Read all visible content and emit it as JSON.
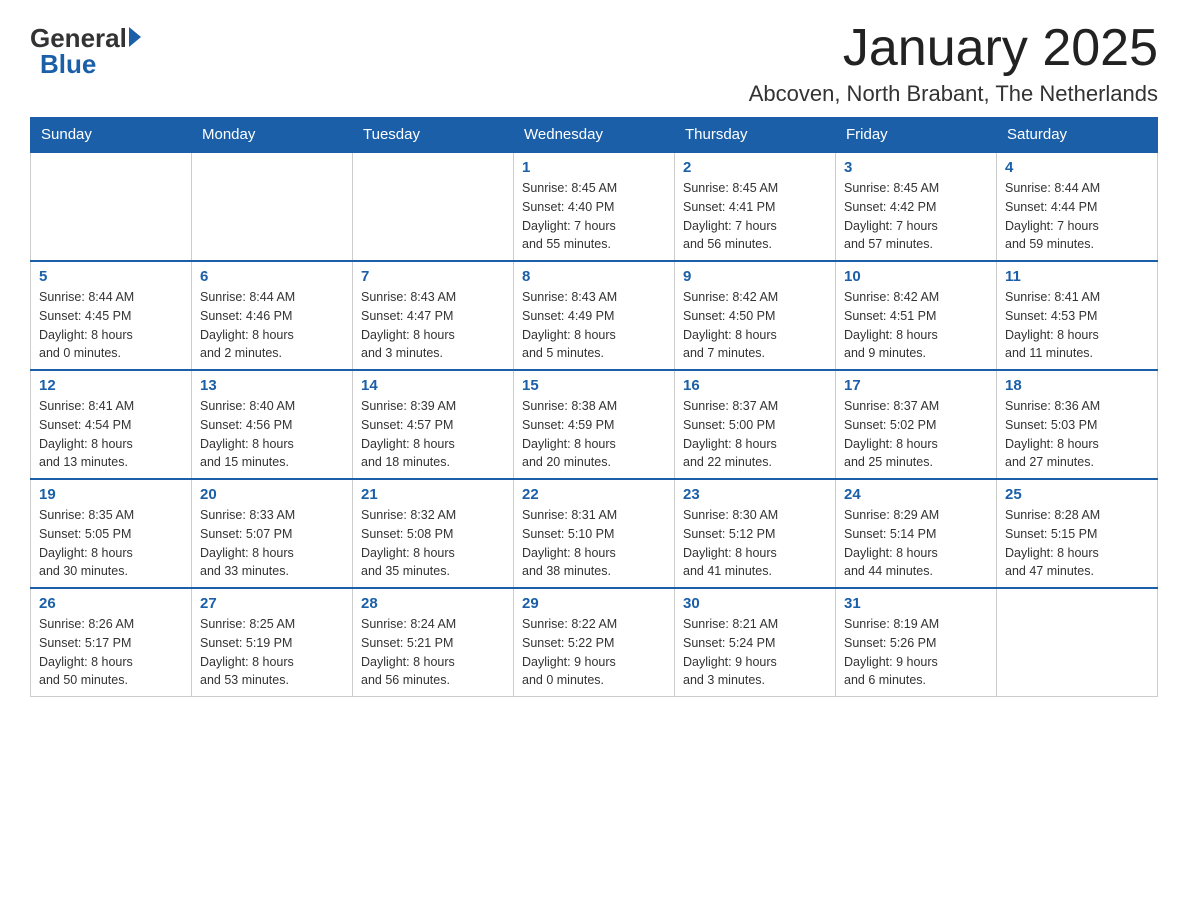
{
  "header": {
    "logo_general": "General",
    "logo_blue": "Blue",
    "month_title": "January 2025",
    "subtitle": "Abcoven, North Brabant, The Netherlands"
  },
  "days_of_week": [
    "Sunday",
    "Monday",
    "Tuesday",
    "Wednesday",
    "Thursday",
    "Friday",
    "Saturday"
  ],
  "weeks": [
    [
      {
        "day": "",
        "info": ""
      },
      {
        "day": "",
        "info": ""
      },
      {
        "day": "",
        "info": ""
      },
      {
        "day": "1",
        "info": "Sunrise: 8:45 AM\nSunset: 4:40 PM\nDaylight: 7 hours\nand 55 minutes."
      },
      {
        "day": "2",
        "info": "Sunrise: 8:45 AM\nSunset: 4:41 PM\nDaylight: 7 hours\nand 56 minutes."
      },
      {
        "day": "3",
        "info": "Sunrise: 8:45 AM\nSunset: 4:42 PM\nDaylight: 7 hours\nand 57 minutes."
      },
      {
        "day": "4",
        "info": "Sunrise: 8:44 AM\nSunset: 4:44 PM\nDaylight: 7 hours\nand 59 minutes."
      }
    ],
    [
      {
        "day": "5",
        "info": "Sunrise: 8:44 AM\nSunset: 4:45 PM\nDaylight: 8 hours\nand 0 minutes."
      },
      {
        "day": "6",
        "info": "Sunrise: 8:44 AM\nSunset: 4:46 PM\nDaylight: 8 hours\nand 2 minutes."
      },
      {
        "day": "7",
        "info": "Sunrise: 8:43 AM\nSunset: 4:47 PM\nDaylight: 8 hours\nand 3 minutes."
      },
      {
        "day": "8",
        "info": "Sunrise: 8:43 AM\nSunset: 4:49 PM\nDaylight: 8 hours\nand 5 minutes."
      },
      {
        "day": "9",
        "info": "Sunrise: 8:42 AM\nSunset: 4:50 PM\nDaylight: 8 hours\nand 7 minutes."
      },
      {
        "day": "10",
        "info": "Sunrise: 8:42 AM\nSunset: 4:51 PM\nDaylight: 8 hours\nand 9 minutes."
      },
      {
        "day": "11",
        "info": "Sunrise: 8:41 AM\nSunset: 4:53 PM\nDaylight: 8 hours\nand 11 minutes."
      }
    ],
    [
      {
        "day": "12",
        "info": "Sunrise: 8:41 AM\nSunset: 4:54 PM\nDaylight: 8 hours\nand 13 minutes."
      },
      {
        "day": "13",
        "info": "Sunrise: 8:40 AM\nSunset: 4:56 PM\nDaylight: 8 hours\nand 15 minutes."
      },
      {
        "day": "14",
        "info": "Sunrise: 8:39 AM\nSunset: 4:57 PM\nDaylight: 8 hours\nand 18 minutes."
      },
      {
        "day": "15",
        "info": "Sunrise: 8:38 AM\nSunset: 4:59 PM\nDaylight: 8 hours\nand 20 minutes."
      },
      {
        "day": "16",
        "info": "Sunrise: 8:37 AM\nSunset: 5:00 PM\nDaylight: 8 hours\nand 22 minutes."
      },
      {
        "day": "17",
        "info": "Sunrise: 8:37 AM\nSunset: 5:02 PM\nDaylight: 8 hours\nand 25 minutes."
      },
      {
        "day": "18",
        "info": "Sunrise: 8:36 AM\nSunset: 5:03 PM\nDaylight: 8 hours\nand 27 minutes."
      }
    ],
    [
      {
        "day": "19",
        "info": "Sunrise: 8:35 AM\nSunset: 5:05 PM\nDaylight: 8 hours\nand 30 minutes."
      },
      {
        "day": "20",
        "info": "Sunrise: 8:33 AM\nSunset: 5:07 PM\nDaylight: 8 hours\nand 33 minutes."
      },
      {
        "day": "21",
        "info": "Sunrise: 8:32 AM\nSunset: 5:08 PM\nDaylight: 8 hours\nand 35 minutes."
      },
      {
        "day": "22",
        "info": "Sunrise: 8:31 AM\nSunset: 5:10 PM\nDaylight: 8 hours\nand 38 minutes."
      },
      {
        "day": "23",
        "info": "Sunrise: 8:30 AM\nSunset: 5:12 PM\nDaylight: 8 hours\nand 41 minutes."
      },
      {
        "day": "24",
        "info": "Sunrise: 8:29 AM\nSunset: 5:14 PM\nDaylight: 8 hours\nand 44 minutes."
      },
      {
        "day": "25",
        "info": "Sunrise: 8:28 AM\nSunset: 5:15 PM\nDaylight: 8 hours\nand 47 minutes."
      }
    ],
    [
      {
        "day": "26",
        "info": "Sunrise: 8:26 AM\nSunset: 5:17 PM\nDaylight: 8 hours\nand 50 minutes."
      },
      {
        "day": "27",
        "info": "Sunrise: 8:25 AM\nSunset: 5:19 PM\nDaylight: 8 hours\nand 53 minutes."
      },
      {
        "day": "28",
        "info": "Sunrise: 8:24 AM\nSunset: 5:21 PM\nDaylight: 8 hours\nand 56 minutes."
      },
      {
        "day": "29",
        "info": "Sunrise: 8:22 AM\nSunset: 5:22 PM\nDaylight: 9 hours\nand 0 minutes."
      },
      {
        "day": "30",
        "info": "Sunrise: 8:21 AM\nSunset: 5:24 PM\nDaylight: 9 hours\nand 3 minutes."
      },
      {
        "day": "31",
        "info": "Sunrise: 8:19 AM\nSunset: 5:26 PM\nDaylight: 9 hours\nand 6 minutes."
      },
      {
        "day": "",
        "info": ""
      }
    ]
  ]
}
